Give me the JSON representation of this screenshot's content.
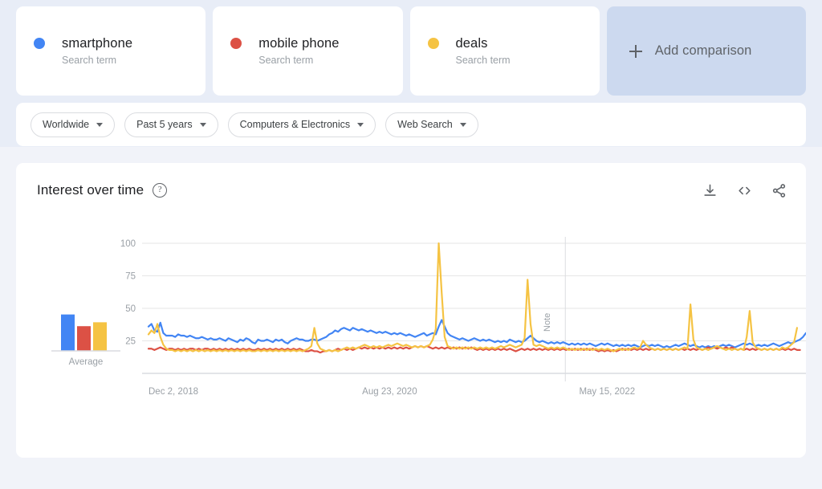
{
  "terms": [
    {
      "name": "smartphone",
      "subtitle": "Search term",
      "color": "#4285f4"
    },
    {
      "name": "mobile phone",
      "subtitle": "Search term",
      "color": "#dc5145"
    },
    {
      "name": "deals",
      "subtitle": "Search term",
      "color": "#f5c343"
    }
  ],
  "add_comparison": {
    "label": "Add comparison",
    "icon": "plus-icon",
    "background": "#ccd9ef"
  },
  "filters": [
    {
      "label": "Worldwide"
    },
    {
      "label": "Past 5 years"
    },
    {
      "label": "Computers & Electronics"
    },
    {
      "label": "Web Search"
    }
  ],
  "chart_panel": {
    "title": "Interest over time",
    "help_glyph": "?",
    "actions": [
      {
        "name": "download-icon",
        "label": "Download"
      },
      {
        "name": "embed-icon",
        "label": "Embed"
      },
      {
        "name": "share-icon",
        "label": "Share"
      }
    ]
  },
  "chart_data": {
    "type": "line",
    "title": "Interest over time",
    "xlabel": "",
    "ylabel": "",
    "ylim": [
      0,
      100
    ],
    "yticks": [
      25,
      50,
      75,
      100
    ],
    "grid": true,
    "legend": "top-cards",
    "xticks": [
      "Dec 2, 2018",
      "Aug 23, 2020",
      "May 15, 2022"
    ],
    "xtick_positions": [
      0,
      0.325,
      0.655
    ],
    "annotations": [
      {
        "text": "Note",
        "x_fraction": 0.634,
        "orientation": "vertical",
        "line": true
      }
    ],
    "average_panel": {
      "label": "Average",
      "values": [
        28,
        19,
        22
      ]
    },
    "series": [
      {
        "name": "smartphone",
        "color": "#4285f4",
        "values": [
          36,
          38,
          33,
          32,
          39,
          31,
          29,
          29,
          29,
          28,
          30,
          29,
          29,
          28,
          29,
          28,
          27,
          27,
          28,
          27,
          26,
          27,
          26,
          26,
          27,
          26,
          25,
          27,
          26,
          25,
          24,
          26,
          25,
          27,
          26,
          24,
          23,
          26,
          25,
          25,
          26,
          25,
          24,
          26,
          25,
          26,
          24,
          23,
          25,
          26,
          27,
          26,
          26,
          25,
          25,
          26,
          26,
          25,
          26,
          27,
          28,
          30,
          31,
          33,
          32,
          34,
          35,
          34,
          33,
          35,
          34,
          33,
          34,
          33,
          32,
          33,
          32,
          31,
          32,
          31,
          32,
          31,
          30,
          31,
          30,
          31,
          30,
          29,
          30,
          29,
          28,
          29,
          30,
          31,
          29,
          30,
          31,
          30,
          36,
          41,
          36,
          31,
          29,
          28,
          27,
          26,
          27,
          26,
          25,
          26,
          27,
          26,
          25,
          26,
          25,
          26,
          25,
          24,
          25,
          24,
          25,
          24,
          26,
          25,
          24,
          25,
          24,
          25,
          27,
          29,
          27,
          25,
          24,
          25,
          24,
          23,
          24,
          23,
          24,
          23,
          24,
          23,
          22,
          23,
          22,
          23,
          22,
          23,
          22,
          23,
          22,
          21,
          22,
          23,
          22,
          23,
          22,
          21,
          22,
          21,
          22,
          21,
          22,
          21,
          22,
          21,
          20,
          21,
          22,
          21,
          22,
          21,
          22,
          21,
          20,
          21,
          20,
          21,
          22,
          21,
          22,
          23,
          22,
          21,
          22,
          21,
          20,
          21,
          20,
          21,
          20,
          21,
          20,
          21,
          22,
          21,
          22,
          21,
          20,
          21,
          22,
          23,
          22,
          23,
          22,
          21,
          22,
          21,
          22,
          21,
          22,
          23,
          22,
          21,
          22,
          23,
          24,
          23,
          24,
          25,
          26,
          28,
          31
        ]
      },
      {
        "name": "mobile phone",
        "color": "#dc5145",
        "values": [
          19,
          19,
          18,
          19,
          20,
          19,
          18,
          19,
          19,
          18,
          19,
          18,
          19,
          18,
          19,
          19,
          18,
          19,
          18,
          19,
          19,
          18,
          19,
          18,
          19,
          18,
          19,
          18,
          19,
          18,
          19,
          18,
          19,
          18,
          19,
          18,
          18,
          19,
          18,
          19,
          18,
          19,
          18,
          19,
          18,
          19,
          18,
          19,
          18,
          19,
          18,
          19,
          18,
          17,
          17,
          18,
          17,
          17,
          16,
          17,
          17,
          18,
          17,
          18,
          19,
          18,
          19,
          18,
          19,
          18,
          19,
          20,
          19,
          20,
          19,
          20,
          19,
          20,
          19,
          20,
          19,
          20,
          19,
          20,
          19,
          20,
          19,
          20,
          19,
          20,
          21,
          20,
          21,
          20,
          21,
          20,
          19,
          20,
          19,
          20,
          19,
          20,
          19,
          20,
          19,
          20,
          19,
          20,
          19,
          20,
          19,
          18,
          19,
          18,
          19,
          18,
          19,
          18,
          19,
          18,
          19,
          18,
          19,
          18,
          17,
          18,
          19,
          18,
          19,
          18,
          19,
          18,
          19,
          18,
          19,
          18,
          19,
          18,
          19,
          18,
          19,
          18,
          19,
          18,
          19,
          18,
          19,
          18,
          19,
          18,
          19,
          18,
          17,
          18,
          17,
          18,
          17,
          18,
          17,
          18,
          19,
          18,
          19,
          18,
          19,
          18,
          19,
          18,
          19,
          18,
          19,
          18,
          19,
          18,
          19,
          18,
          19,
          18,
          19,
          18,
          19,
          18,
          19,
          18,
          19,
          18,
          19,
          18,
          19,
          20,
          19,
          20,
          19,
          20,
          19,
          20,
          19,
          20,
          19,
          18,
          19,
          18,
          19,
          18,
          19,
          18,
          19,
          18,
          19,
          18,
          19,
          18,
          19,
          18,
          19,
          18,
          19,
          18,
          19,
          18,
          18
        ]
      },
      {
        "name": "deals",
        "color": "#f5c343",
        "values": [
          30,
          33,
          31,
          38,
          28,
          22,
          19,
          18,
          18,
          17,
          18,
          17,
          18,
          17,
          18,
          17,
          18,
          17,
          18,
          17,
          18,
          17,
          18,
          17,
          18,
          17,
          18,
          17,
          18,
          17,
          18,
          17,
          18,
          17,
          18,
          17,
          17,
          18,
          17,
          18,
          17,
          18,
          17,
          18,
          17,
          18,
          17,
          18,
          17,
          18,
          17,
          18,
          17,
          18,
          19,
          21,
          35,
          23,
          19,
          18,
          17,
          18,
          17,
          18,
          17,
          18,
          19,
          20,
          19,
          20,
          19,
          20,
          21,
          22,
          21,
          20,
          21,
          20,
          21,
          20,
          21,
          22,
          21,
          22,
          23,
          22,
          21,
          22,
          21,
          20,
          21,
          20,
          21,
          20,
          21,
          22,
          26,
          34,
          100,
          62,
          28,
          21,
          20,
          19,
          20,
          19,
          20,
          19,
          20,
          19,
          20,
          19,
          20,
          19,
          20,
          19,
          20,
          19,
          20,
          21,
          20,
          21,
          22,
          21,
          20,
          21,
          22,
          27,
          72,
          38,
          22,
          21,
          22,
          21,
          20,
          19,
          20,
          19,
          20,
          19,
          20,
          19,
          18,
          19,
          18,
          19,
          18,
          19,
          18,
          19,
          18,
          19,
          18,
          19,
          18,
          19,
          18,
          17,
          18,
          19,
          18,
          19,
          18,
          19,
          20,
          19,
          20,
          25,
          22,
          20,
          19,
          18,
          19,
          18,
          19,
          18,
          19,
          18,
          19,
          18,
          19,
          20,
          19,
          53,
          26,
          20,
          19,
          18,
          19,
          18,
          19,
          20,
          21,
          20,
          19,
          18,
          19,
          18,
          19,
          18,
          19,
          18,
          28,
          48,
          24,
          20,
          19,
          18,
          19,
          18,
          19,
          18,
          19,
          18,
          20,
          19,
          20,
          22,
          24,
          35
        ]
      }
    ]
  }
}
